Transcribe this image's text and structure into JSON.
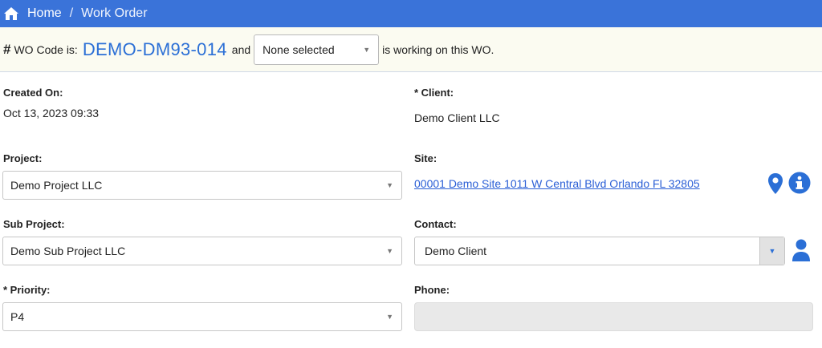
{
  "breadcrumb": {
    "home": "Home",
    "separator": "/",
    "current": "Work Order"
  },
  "wo_bar": {
    "hash": "#",
    "prefix": "WO Code is:",
    "code": "DEMO-DM93-014",
    "and": "and",
    "assignee_select": "None selected",
    "suffix": "is working on this WO."
  },
  "fields": {
    "created_on": {
      "label": "Created On:",
      "value": "Oct 13, 2023 09:33"
    },
    "client": {
      "label": "* Client:",
      "value": "Demo Client LLC"
    },
    "project": {
      "label": "Project:",
      "value": "Demo Project LLC"
    },
    "site": {
      "label": "Site:",
      "value": "00001 Demo Site 1011 W Central Blvd Orlando FL 32805"
    },
    "sub_project": {
      "label": "Sub Project:",
      "value": "Demo Sub Project LLC"
    },
    "contact": {
      "label": "Contact:",
      "value": "Demo Client"
    },
    "priority": {
      "label": "* Priority:",
      "value": "P4"
    },
    "phone": {
      "label": "Phone:",
      "value": ""
    }
  },
  "colors": {
    "topbar": "#3a73d9",
    "accent": "#2b6fd6",
    "wo_bar_bg": "#fbfbf1"
  },
  "icons": [
    "home-icon",
    "map-pin-icon",
    "info-icon",
    "user-icon",
    "chevron-down-icon"
  ]
}
